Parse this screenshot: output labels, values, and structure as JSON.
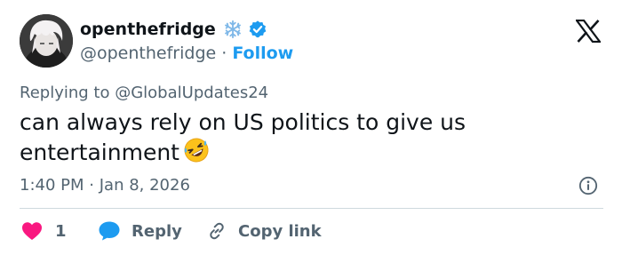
{
  "author": {
    "display_name": "openthefridge",
    "handle": "@openthefridge",
    "separator": "·",
    "follow_label": "Follow"
  },
  "icons": {
    "snowflake": "snowflake-icon",
    "verified": "verified-badge-icon",
    "brand": "x-logo-icon",
    "info": "info-icon",
    "like": "heart-icon",
    "reply": "reply-bubble-icon",
    "copy": "link-icon",
    "emoji": "rolling-on-floor-laughing-emoji"
  },
  "reply_context": {
    "prefix": "Replying to",
    "to_handle": "@GlobalUpdates24"
  },
  "tweet": {
    "text": "can always rely on US politics to give us entertainment"
  },
  "meta": {
    "time": "1:40 PM",
    "separator": "·",
    "date": "Jan 8, 2026"
  },
  "actions": {
    "like_count": "1",
    "reply_label": "Reply",
    "copy_label": "Copy link"
  },
  "colors": {
    "accent": "#1d9bf0",
    "like": "#f91880",
    "text": "#0f1419",
    "secondary": "#536471",
    "divider": "#cfd9de"
  }
}
